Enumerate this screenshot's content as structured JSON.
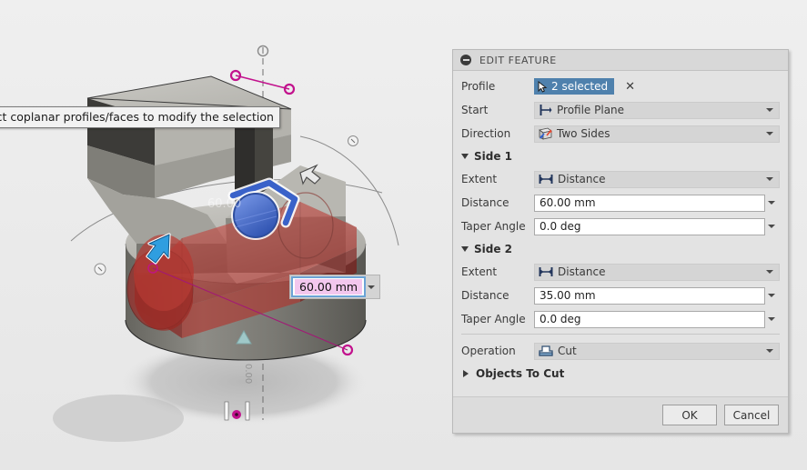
{
  "app": {
    "viewport_background": "#ececec"
  },
  "tooltip": {
    "name": "status-tooltip",
    "text": "ecify distance, or select coplanar profiles/faces to modify the selection"
  },
  "canvas_dimension": {
    "name": "dimension-input",
    "value": "60.00 mm",
    "highlight_color": "#f3c7ee",
    "focus_border_color": "#6ba3d6"
  },
  "panel": {
    "title": "EDIT FEATURE",
    "collapse_icon": "minus-circle-icon",
    "accent_color": "#4f81ad",
    "rows": {
      "profile": {
        "label": "Profile",
        "chip_icon": "cursor-arrow-icon",
        "chip_text": "2 selected",
        "clear_icon": "close-icon"
      },
      "start": {
        "label": "Start",
        "icon": "profile-plane-icon",
        "value": "Profile Plane"
      },
      "direction": {
        "label": "Direction",
        "icon": "two-sides-icon",
        "value": "Two Sides"
      }
    },
    "side1": {
      "header": "Side 1",
      "extent": {
        "label": "Extent",
        "icon": "distance-icon",
        "value": "Distance"
      },
      "distance": {
        "label": "Distance",
        "value": "60.00 mm"
      },
      "taper": {
        "label": "Taper Angle",
        "value": "0.0 deg"
      }
    },
    "side2": {
      "header": "Side 2",
      "extent": {
        "label": "Extent",
        "icon": "distance-icon",
        "value": "Distance"
      },
      "distance": {
        "label": "Distance",
        "value": "35.00 mm"
      },
      "taper": {
        "label": "Taper Angle",
        "value": "0.0 deg"
      }
    },
    "operation": {
      "label": "Operation",
      "icon": "cut-icon",
      "value": "Cut"
    },
    "objects_to_cut": {
      "label": "Objects To Cut",
      "expander_icon": "chevron-right-icon"
    },
    "footer": {
      "ok": "OK",
      "cancel": "Cancel"
    }
  },
  "model": {
    "body_color": "#8a8a84",
    "preview_color": "#c0392b",
    "manipulator_color": "#2f6fd0",
    "dimension_marker_color": "#c2128d"
  }
}
